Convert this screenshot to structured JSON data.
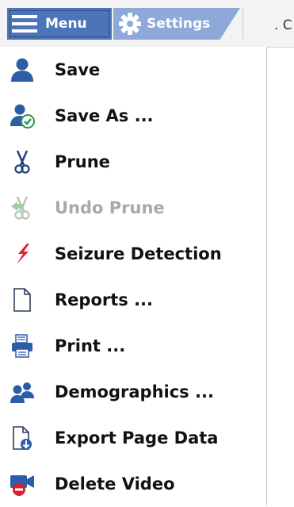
{
  "toolbar": {
    "menu_label": "Menu",
    "settings_label": "Settings",
    "next_tab_label": ". C"
  },
  "menu": {
    "items": [
      {
        "label": "Save",
        "icon": "user-icon",
        "enabled": true
      },
      {
        "label": "Save As ...",
        "icon": "user-check-icon",
        "enabled": true
      },
      {
        "label": "Prune",
        "icon": "scissors-icon",
        "enabled": true
      },
      {
        "label": "Undo Prune",
        "icon": "undo-scissors-icon",
        "enabled": false
      },
      {
        "label": "Seizure Detection",
        "icon": "lightning-icon",
        "enabled": true
      },
      {
        "label": "Reports ...",
        "icon": "document-icon",
        "enabled": true
      },
      {
        "label": "Print ...",
        "icon": "printer-icon",
        "enabled": true
      },
      {
        "label": "Demographics ...",
        "icon": "users-icon",
        "enabled": true
      },
      {
        "label": "Export Page Data",
        "icon": "export-icon",
        "enabled": true
      },
      {
        "label": "Delete Video",
        "icon": "delete-video-icon",
        "enabled": true
      }
    ]
  },
  "colors": {
    "menu_button": "#4d74b8",
    "settings_tab": "#8ea9d8",
    "icon_blue": "#2c5ea8",
    "lightning_red": "#e0242e",
    "disabled_text": "#a9a9a9"
  }
}
